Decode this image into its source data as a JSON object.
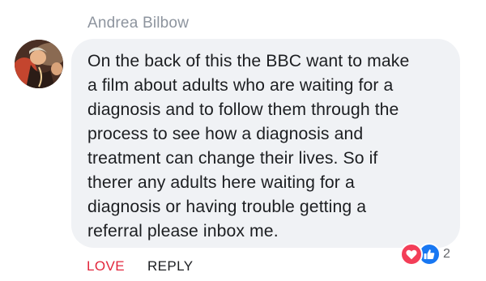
{
  "comment": {
    "author": "Andrea Bilbow",
    "lines": [
      "On the back of this the BBC want to make",
      "a film about adults who are waiting for a",
      "diagnosis and to follow them through the",
      "process to see how a diagnosis and",
      "treatment can change their lives. So if",
      "therer any adults here waiting for a",
      "diagnosis or having trouble getting a",
      "referral please inbox me."
    ]
  },
  "reactions": {
    "count": "2",
    "icons": [
      "heart-icon",
      "thumbs-up-icon"
    ]
  },
  "actions": {
    "love_label": "LOVE",
    "reply_label": "REPLY"
  },
  "colors": {
    "love": "#e2263c",
    "like": "#1877f2",
    "bubble": "#f0f2f5"
  }
}
